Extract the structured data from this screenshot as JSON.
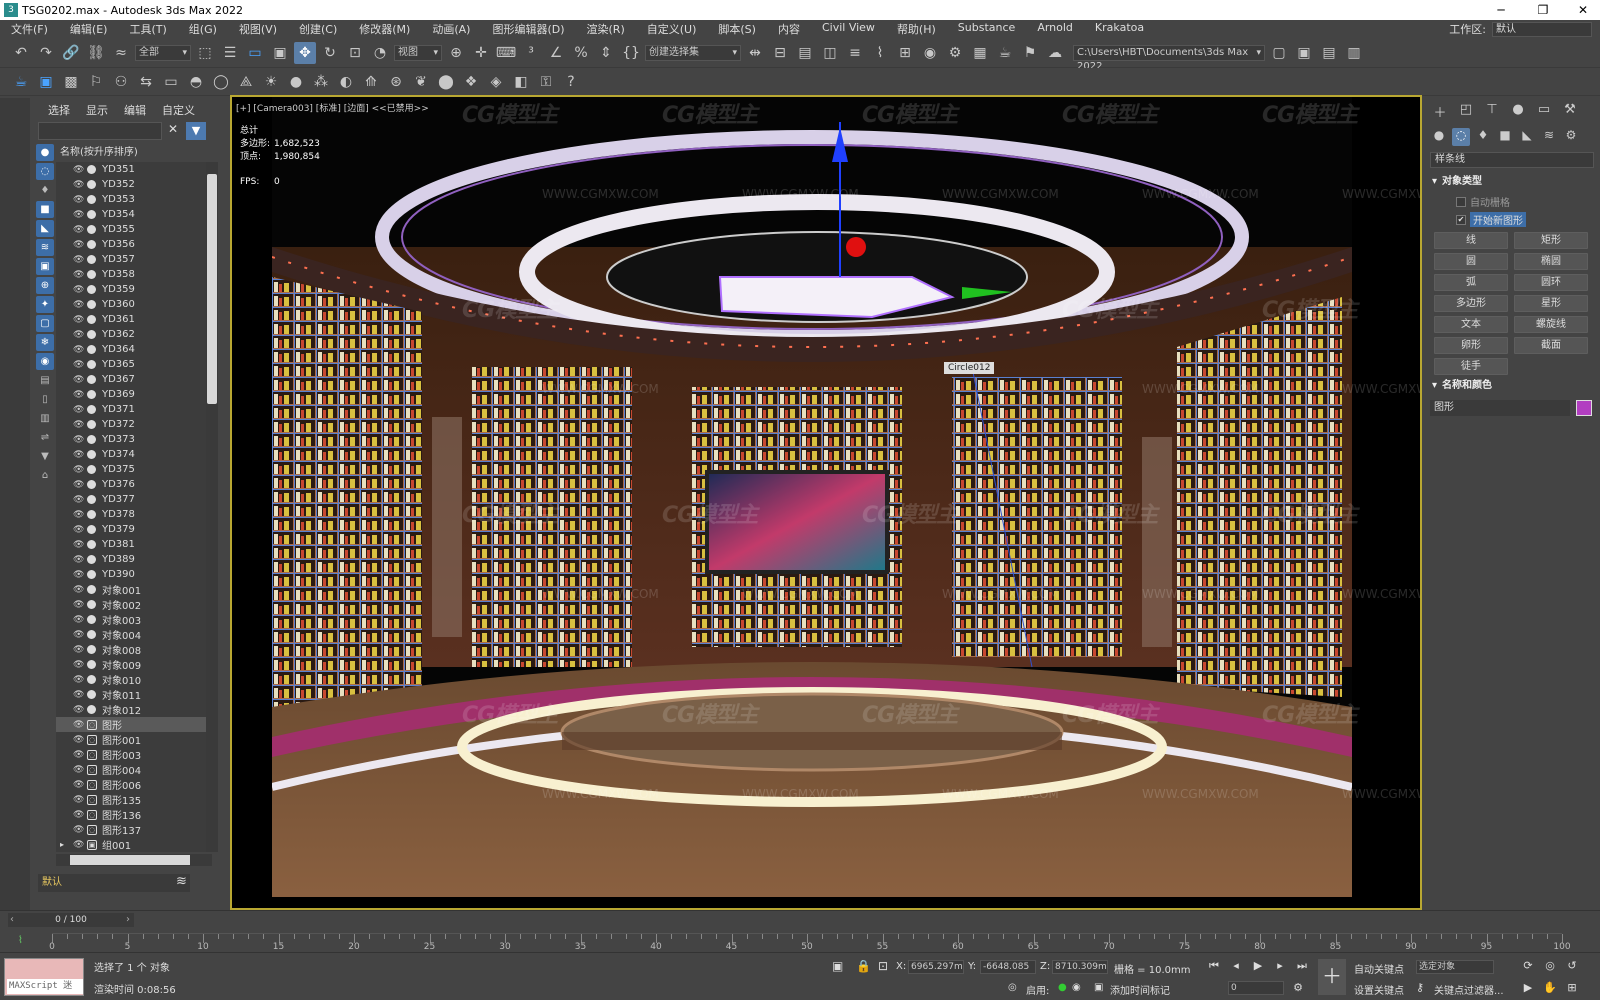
{
  "window": {
    "title": "TSG0202.max - Autodesk 3ds Max 2022",
    "minimize": "─",
    "restore": "❐",
    "close": "✕"
  },
  "menu": {
    "items": [
      "文件(F)",
      "编辑(E)",
      "工具(T)",
      "组(G)",
      "视图(V)",
      "创建(C)",
      "修改器(M)",
      "动画(A)",
      "图形编辑器(D)",
      "渲染(R)",
      "自定义(U)",
      "脚本(S)",
      "内容",
      "Civil View",
      "帮助(H)",
      "Substance",
      "Arnold",
      "Krakatoa"
    ],
    "workspace_label": "工作区:",
    "workspace_value": "默认"
  },
  "toolbar1": {
    "selection_filter": "全部",
    "ref_coord": "视图",
    "named_selection": "创建选择集",
    "project_path": "C:\\Users\\HBT\\Documents\\3ds Max 2022"
  },
  "explorer": {
    "tabs": [
      "选择",
      "显示",
      "编辑",
      "自定义"
    ],
    "column_header": "名称(按升序排序)",
    "layer": "默认",
    "items": [
      {
        "name": "YD351",
        "type": "mesh"
      },
      {
        "name": "YD352",
        "type": "mesh"
      },
      {
        "name": "YD353",
        "type": "mesh"
      },
      {
        "name": "YD354",
        "type": "mesh"
      },
      {
        "name": "YD355",
        "type": "mesh"
      },
      {
        "name": "YD356",
        "type": "mesh"
      },
      {
        "name": "YD357",
        "type": "mesh"
      },
      {
        "name": "YD358",
        "type": "mesh"
      },
      {
        "name": "YD359",
        "type": "mesh"
      },
      {
        "name": "YD360",
        "type": "mesh"
      },
      {
        "name": "YD361",
        "type": "mesh"
      },
      {
        "name": "YD362",
        "type": "mesh"
      },
      {
        "name": "YD364",
        "type": "mesh"
      },
      {
        "name": "YD365",
        "type": "mesh"
      },
      {
        "name": "YD367",
        "type": "mesh"
      },
      {
        "name": "YD369",
        "type": "mesh"
      },
      {
        "name": "YD371",
        "type": "mesh"
      },
      {
        "name": "YD372",
        "type": "mesh"
      },
      {
        "name": "YD373",
        "type": "mesh"
      },
      {
        "name": "YD374",
        "type": "mesh"
      },
      {
        "name": "YD375",
        "type": "mesh"
      },
      {
        "name": "YD376",
        "type": "mesh"
      },
      {
        "name": "YD377",
        "type": "mesh"
      },
      {
        "name": "YD378",
        "type": "mesh"
      },
      {
        "name": "YD379",
        "type": "mesh"
      },
      {
        "name": "YD381",
        "type": "mesh"
      },
      {
        "name": "YD389",
        "type": "mesh"
      },
      {
        "name": "YD390",
        "type": "mesh"
      },
      {
        "name": "对象001",
        "type": "mesh"
      },
      {
        "name": "对象002",
        "type": "mesh"
      },
      {
        "name": "对象003",
        "type": "mesh"
      },
      {
        "name": "对象004",
        "type": "mesh"
      },
      {
        "name": "对象008",
        "type": "mesh"
      },
      {
        "name": "对象009",
        "type": "mesh"
      },
      {
        "name": "对象010",
        "type": "mesh"
      },
      {
        "name": "对象011",
        "type": "mesh"
      },
      {
        "name": "对象012",
        "type": "mesh"
      },
      {
        "name": "图形",
        "type": "shape",
        "selected": true
      },
      {
        "name": "图形001",
        "type": "shape"
      },
      {
        "name": "图形003",
        "type": "shape"
      },
      {
        "name": "图形004",
        "type": "shape"
      },
      {
        "name": "图形006",
        "type": "shape"
      },
      {
        "name": "图形135",
        "type": "shape"
      },
      {
        "name": "图形136",
        "type": "shape"
      },
      {
        "name": "图形137",
        "type": "shape"
      },
      {
        "name": "组001",
        "type": "group"
      }
    ]
  },
  "viewport": {
    "label": "[+] [Camera003] [标准] [边面] <<已禁用>>",
    "stats_title": "总计",
    "polys_label": "多边形:",
    "polys": "1,682,523",
    "verts_label": "顶点:",
    "verts": "1,980,854",
    "fps_label": "FPS:",
    "fps": "0",
    "object_tag": "Circle012",
    "watermark": "CG模型主",
    "watermark_url": "WWW.CGMXW.COM"
  },
  "command_panel": {
    "category": "样条线",
    "rollout_object_type": "对象类型",
    "auto_grid": "自动栅格",
    "start_new_shape": "开始新图形",
    "buttons": [
      "线",
      "矩形",
      "圆",
      "椭圆",
      "弧",
      "圆环",
      "多边形",
      "星形",
      "文本",
      "螺旋线",
      "卵形",
      "截面",
      "徒手"
    ],
    "rollout_name_color": "名称和颜色",
    "name_value": "图形",
    "color": "#b23ec1"
  },
  "timeline": {
    "frame": "0 / 100",
    "ticks": [
      0,
      5,
      10,
      15,
      20,
      25,
      30,
      35,
      40,
      45,
      50,
      55,
      60,
      65,
      70,
      75,
      80,
      85,
      90,
      95,
      100
    ]
  },
  "status": {
    "maxscript": "MAXScript 迷",
    "selected": "选择了 1 个 对象",
    "render_time": "渲染时间  0:08:56",
    "x_label": "X:",
    "x": "6965.297m",
    "y_label": "Y:",
    "y": "-6648.085",
    "z_label": "Z:",
    "z": "8710.309m",
    "grid": "栅格 = 10.0mm",
    "enabled": "启用:",
    "add_time_tag": "添加时间标记",
    "auto_key": "自动关键点",
    "set_key": "设置关键点",
    "selected_object": "选定对象",
    "key_filters": "关键点过滤器...",
    "frame_field": "0"
  }
}
